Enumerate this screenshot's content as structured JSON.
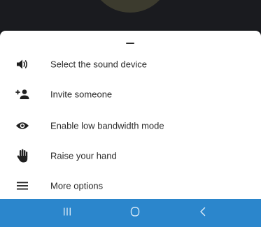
{
  "menu": {
    "items": [
      {
        "label": "Select the sound device",
        "icon": "speaker-icon"
      },
      {
        "label": "Invite someone",
        "icon": "add-person-icon"
      },
      {
        "label": "Enable low bandwidth mode",
        "icon": "eye-icon"
      },
      {
        "label": "Raise your hand",
        "icon": "hand-icon"
      },
      {
        "label": "More options",
        "icon": "menu-icon"
      }
    ]
  },
  "navbar": {
    "buttons": [
      "recents-icon",
      "home-icon",
      "back-icon"
    ],
    "color": "#2b86cc"
  },
  "colors": {
    "icon": "#1f1f1f",
    "text": "#2a2a2a",
    "backdrop": "#1a1b1f"
  }
}
